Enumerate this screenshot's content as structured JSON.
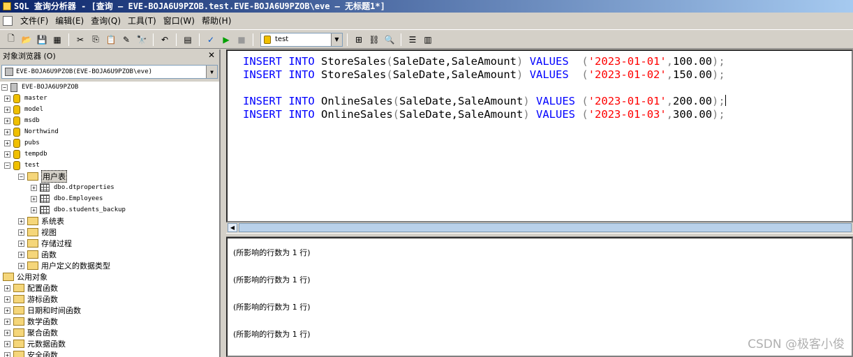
{
  "window": {
    "title": "SQL 查询分析器 - [查询 — EVE-BOJA6U9PZOB.test.EVE-BOJA6U9PZOB\\eve — 无标题1*]"
  },
  "menu": [
    "文件(F)",
    "编辑(E)",
    "查询(Q)",
    "工具(T)",
    "窗口(W)",
    "帮助(H)"
  ],
  "toolbar": {
    "database": "test"
  },
  "object_browser": {
    "title": "对象浏览器 (O)",
    "server_combo": "EVE-BOJA6U9PZOB(EVE-BOJA6U9PZOB\\eve)",
    "server": "EVE-BOJA6U9PZOB",
    "databases": [
      "master",
      "model",
      "msdb",
      "Northwind",
      "pubs",
      "tempdb",
      "test"
    ],
    "test_folders": {
      "user_tables": "用户表",
      "tables": [
        "dbo.dtproperties",
        "dbo.Employees",
        "dbo.students_backup"
      ],
      "system_tables": "系统表",
      "views": "视图",
      "procedures": "存储过程",
      "functions": "函数",
      "udt": "用户定义的数据类型"
    },
    "common_objects": "公用对象",
    "common_items": [
      "配置函数",
      "游标函数",
      "日期和时间函数",
      "数学函数",
      "聚合函数",
      "元数据函数",
      "安全函数"
    ]
  },
  "editor": {
    "lines": [
      {
        "kw1": "INSERT",
        "kw2": "INTO",
        "table": "StoreSales",
        "cols": "SaleDate,SaleAmount",
        "kw3": "VALUES",
        "date": "'2023-01-01'",
        "amount": "100.00"
      },
      {
        "kw1": "INSERT",
        "kw2": "INTO",
        "table": "StoreSales",
        "cols": "SaleDate,SaleAmount",
        "kw3": "VALUES",
        "date": "'2023-01-02'",
        "amount": "150.00"
      },
      {
        "kw1": "INSERT",
        "kw2": "INTO",
        "table": "OnlineSales",
        "cols": "SaleDate,SaleAmount",
        "kw3": "VALUES",
        "date": "'2023-01-01'",
        "amount": "200.00"
      },
      {
        "kw1": "INSERT",
        "kw2": "INTO",
        "table": "OnlineSales",
        "cols": "SaleDate,SaleAmount",
        "kw3": "VALUES",
        "date": "'2023-01-03'",
        "amount": "300.00"
      }
    ]
  },
  "results": [
    "(所影响的行数为 1 行)",
    "(所影响的行数为 1 行)",
    "(所影响的行数为 1 行)",
    "(所影响的行数为 1 行)"
  ],
  "watermark": "CSDN @极客小俊"
}
